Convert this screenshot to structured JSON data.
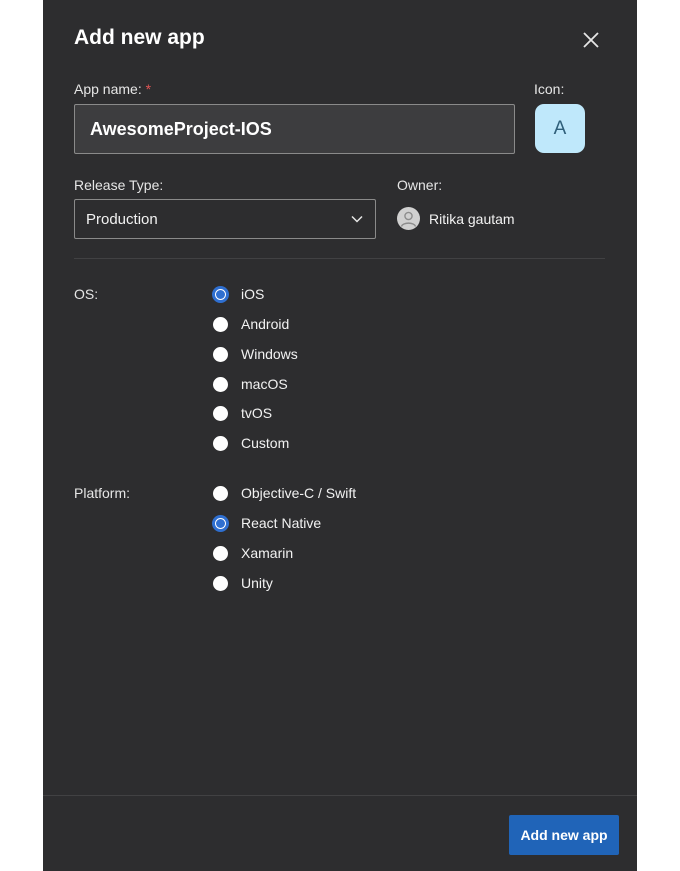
{
  "dialog": {
    "title": "Add new app",
    "close_icon": "close-icon"
  },
  "app_name": {
    "label": "App name:",
    "required_mark": "*",
    "value": "AwesomeProject-IOS"
  },
  "icon": {
    "label": "Icon:",
    "letter": "A",
    "color": "#bfe8fb"
  },
  "release_type": {
    "label": "Release Type:",
    "selected": "Production",
    "icon": "chevron-down-icon"
  },
  "owner": {
    "label": "Owner:",
    "name": "Ritika gautam",
    "avatar_icon": "person-icon"
  },
  "os": {
    "label": "OS:",
    "options": [
      "iOS",
      "Android",
      "Windows",
      "macOS",
      "tvOS",
      "Custom"
    ],
    "selected": "iOS"
  },
  "platform": {
    "label": "Platform:",
    "options": [
      "Objective-C / Swift",
      "React Native",
      "Xamarin",
      "Unity"
    ],
    "selected": "React Native"
  },
  "footer": {
    "submit_label": "Add new app",
    "accent": "#2064b8"
  }
}
